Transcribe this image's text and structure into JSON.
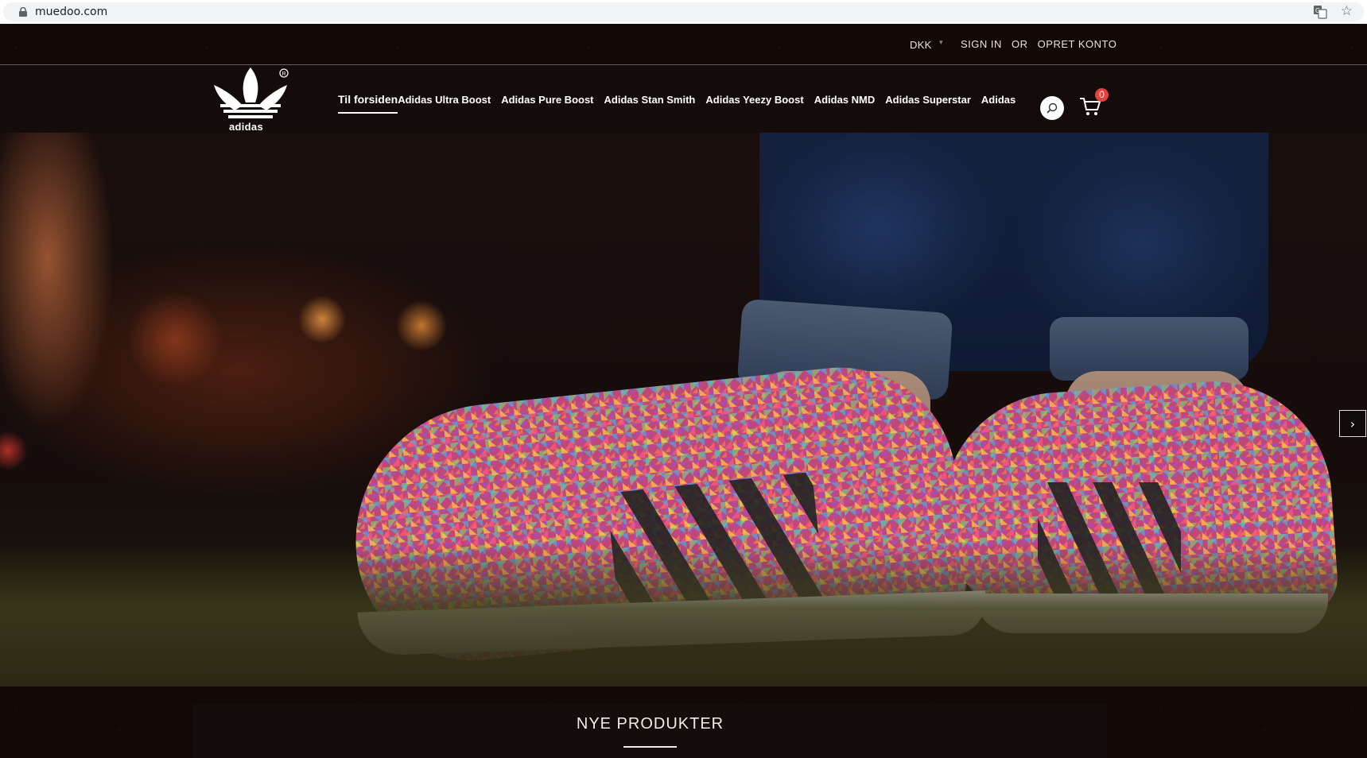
{
  "browser": {
    "url": "muedoo.com",
    "icons": {
      "lock": "lock-icon",
      "translate": "translate-icon",
      "star": "star-icon"
    }
  },
  "top_bar": {
    "currency": "DKK",
    "sign_in": "SIGN IN",
    "or": "OR",
    "create_account": "OPRET KONTO"
  },
  "header": {
    "logo_text": "adidas",
    "nav": [
      {
        "label": "Til forsiden",
        "active": true
      },
      {
        "label": "Adidas Ultra Boost"
      },
      {
        "label": "Adidas Pure Boost"
      },
      {
        "label": "Adidas Stan Smith"
      },
      {
        "label": "Adidas Yeezy Boost"
      },
      {
        "label": "Adidas NMD"
      },
      {
        "label": "Adidas Superstar"
      },
      {
        "label": "Adidas"
      }
    ],
    "cart_count": "0",
    "icons": {
      "search": "search-icon",
      "cart": "cart-icon"
    }
  },
  "hero": {
    "next_icon": "chevron-right-icon"
  },
  "section": {
    "title": "NYE PRODUKTER"
  },
  "colors": {
    "badge": "#e8413c",
    "background": "#120907"
  }
}
